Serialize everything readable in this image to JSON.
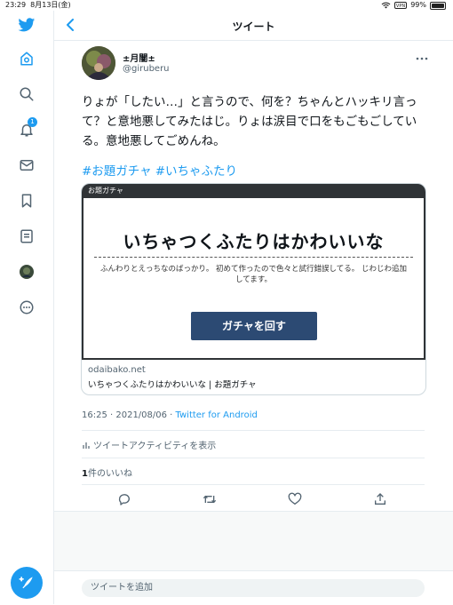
{
  "status_bar": {
    "time": "23:29",
    "date": "8月13日(金)",
    "battery": "99%",
    "battery_level": 0.99
  },
  "sidebar": {
    "notifications_badge": "1"
  },
  "header": {
    "title": "ツイート"
  },
  "tweet": {
    "display_name": "±月闇±",
    "handle": "@giruberu",
    "text": "りょが「したい…」と言うので、何を？ちゃんとハッキリ言って？と意地悪してみたはじ。りょは涙目で口をもごもごしている。意地悪してごめんね。",
    "hashtags": [
      "#お題ガチャ",
      "#いちゃふたり"
    ],
    "timestamp": "16:25 · 2021/08/06 · ",
    "source": "Twitter for Android"
  },
  "card": {
    "label": "お題ガチャ",
    "heading": "いちゃつくふたりはかわいいな",
    "description": "ふんわりとえっちなのばっかり。 初めて作ったので色々と試行錯誤してる。 じわじわ追加してます。",
    "button_label": "ガチャを回す",
    "domain": "odaibako.net",
    "title": "いちゃつくふたりはかわいいな | お題ガチャ"
  },
  "activity": {
    "label": "ツイートアクティビティを表示"
  },
  "likes": {
    "count": "1",
    "label": "件のいいね"
  },
  "reply": {
    "placeholder": "ツイートを追加"
  },
  "colors": {
    "accent": "#1d9bf0",
    "card_button": "#2c4a73",
    "card_header": "#2f3336"
  }
}
